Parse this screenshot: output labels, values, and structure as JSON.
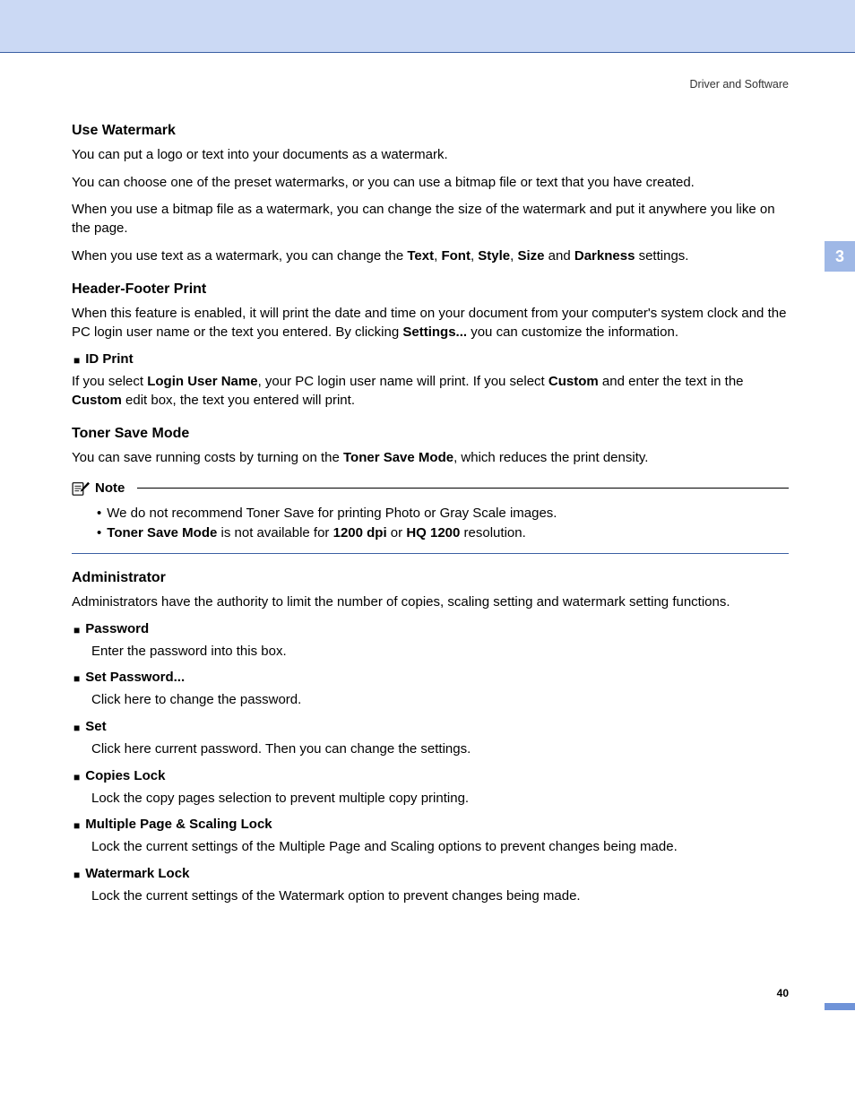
{
  "runningHead": "Driver and Software",
  "chapterTab": "3",
  "pageNumber": "40",
  "noteLabel": "Note",
  "sections": {
    "watermark": {
      "title": "Use Watermark",
      "p1": "You can put a logo or text into your documents as a watermark.",
      "p2": "You can choose one of the preset watermarks, or you can use a bitmap file or text that you have created.",
      "p3": "When you use a bitmap file as a watermark, you can change the size of the watermark and put it anywhere you like on the page.",
      "p4_a": "When you use text as a watermark, you can change the ",
      "p4_text": "Text",
      "p4_c1": ", ",
      "p4_font": "Font",
      "p4_c2": ", ",
      "p4_style": "Style",
      "p4_c3": ", ",
      "p4_size": "Size",
      "p4_and": " and ",
      "p4_dark": "Darkness",
      "p4_end": " settings."
    },
    "header": {
      "title": "Header-Footer Print",
      "p1_a": "When this feature is enabled, it will print the date and time on your document from your computer's system clock and the PC login user name or the text you entered. By clicking ",
      "p1_settings": "Settings...",
      "p1_b": " you can customize the information.",
      "id_title": "ID Print",
      "id_a": "If you select ",
      "id_login": "Login User Name",
      "id_b": ", your PC login user name will print. If you select ",
      "id_custom": "Custom",
      "id_c": " and enter the text in the ",
      "id_custom2": "Custom",
      "id_d": " edit box, the text you entered will print."
    },
    "toner": {
      "title": "Toner Save Mode",
      "p1_a": "You can save running costs by turning on the ",
      "p1_b": "Toner Save Mode",
      "p1_c": ", which reduces the print density.",
      "note1": "We do not recommend Toner Save for printing Photo or Gray Scale images.",
      "note2_a": "Toner Save Mode",
      "note2_b": " is not available for ",
      "note2_c": "1200 dpi",
      "note2_d": " or ",
      "note2_e": "HQ 1200",
      "note2_f": " resolution."
    },
    "admin": {
      "title": "Administrator",
      "p1": "Administrators have the authority to limit the number of copies, scaling setting and watermark setting functions.",
      "items": [
        {
          "title": "Password",
          "body": "Enter the password into this box."
        },
        {
          "title": "Set Password...",
          "body": "Click here to change the password."
        },
        {
          "title": "Set",
          "body": "Click here current password. Then you can change the settings."
        },
        {
          "title": "Copies Lock",
          "body": "Lock the copy pages selection to prevent multiple copy printing."
        },
        {
          "title": "Multiple Page & Scaling Lock",
          "body": "Lock the current settings of the Multiple Page and Scaling options to prevent changes being made."
        },
        {
          "title": "Watermark Lock",
          "body": "Lock the current settings of the Watermark option to prevent changes being made."
        }
      ]
    }
  }
}
